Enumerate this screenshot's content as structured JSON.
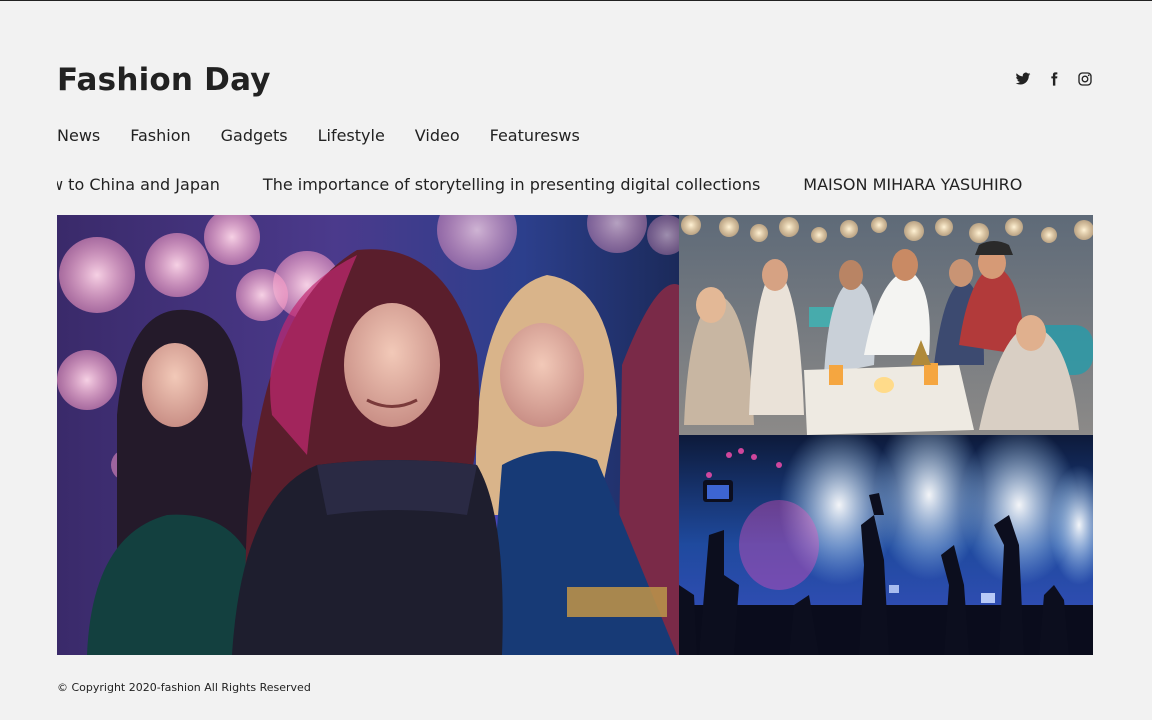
{
  "site": {
    "title": "Fashion Day"
  },
  "social": [
    {
      "icon": "twitter-icon"
    },
    {
      "icon": "facebook-icon"
    },
    {
      "icon": "instagram-icon"
    }
  ],
  "nav": {
    "items": [
      {
        "label": "News"
      },
      {
        "label": "Fashion"
      },
      {
        "label": "Gadgets"
      },
      {
        "label": "Lifestyle"
      },
      {
        "label": "Video"
      },
      {
        "label": "Featuresws"
      }
    ]
  },
  "ticker": {
    "items": [
      {
        "label": "s mensewar show to China and Japan"
      },
      {
        "label": "The importance of storytelling in presenting digital collections"
      },
      {
        "label": "MAISON MIHARA YASUHIRO"
      }
    ]
  },
  "gallery": {
    "images": [
      {
        "icon": "party-photo-image"
      },
      {
        "icon": "beach-party-photo-image"
      },
      {
        "icon": "concert-crowd-photo-image"
      }
    ]
  },
  "footer": {
    "copyright": "© Copyright 2020-fashion All Rights Reserved"
  },
  "colors": {
    "background": "#f2f2f2",
    "text": "#222222"
  }
}
